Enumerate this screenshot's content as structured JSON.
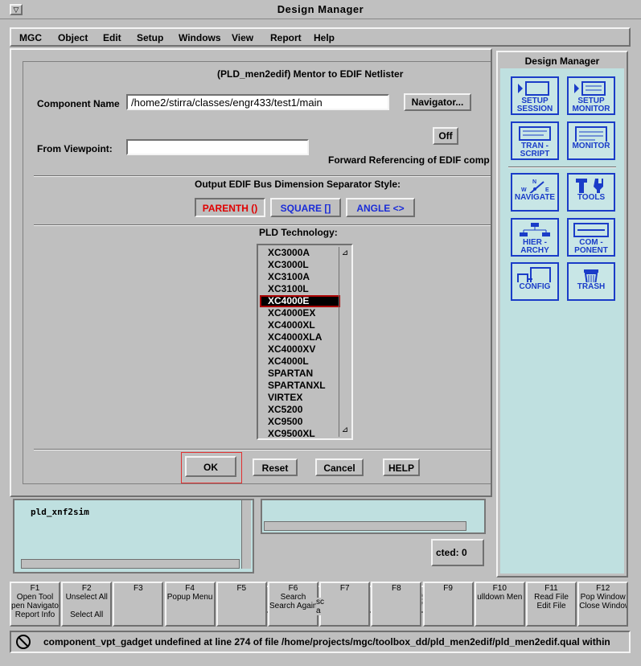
{
  "window": {
    "title": "Design Manager",
    "sys_menu_glyph": "▽"
  },
  "menubar": [
    {
      "label": "MGC"
    },
    {
      "label": "Object"
    },
    {
      "label": "Edit"
    },
    {
      "label": "Setup"
    },
    {
      "label": "Windows"
    },
    {
      "label": "View"
    },
    {
      "label": "Report"
    },
    {
      "label": "Help"
    }
  ],
  "dialog": {
    "title": "(PLD_men2edif) Mentor to EDIF Netlister",
    "component_name_label": "Component Name",
    "component_name_value": "/home2/stirra/classes/engr433/test1/main",
    "navigator_button": "Navigator...",
    "from_viewpoint_label": "From Viewpoint:",
    "from_viewpoint_value": "",
    "off_button": "Off",
    "forward_ref_label": "Forward Referencing of EDIF comp",
    "bus_separator_label": "Output EDIF Bus Dimension Separator Style:",
    "bus_options": [
      {
        "label": "PARENTH ()",
        "color": "#e00000",
        "selected": true
      },
      {
        "label": "SQUARE []",
        "color": "#1a2cd8",
        "selected": false
      },
      {
        "label": "ANGLE  <>",
        "color": "#1a2cd8",
        "selected": false
      }
    ],
    "pld_tech_label": "PLD Technology:",
    "pld_items": [
      "XC3000A",
      "XC3000L",
      "XC3100A",
      "XC3100L",
      "XC4000E",
      "XC4000EX",
      "XC4000XL",
      "XC4000XLA",
      "XC4000XV",
      "XC4000L",
      "SPARTAN",
      "SPARTANXL",
      "VIRTEX",
      "XC5200",
      "XC9500",
      "XC9500XL"
    ],
    "pld_selected": "XC4000E",
    "buttons": {
      "ok": "OK",
      "reset": "Reset",
      "cancel": "Cancel",
      "help": "HELP"
    }
  },
  "dm_panel": {
    "title": "Design Manager",
    "tools": [
      {
        "l1": "SETUP",
        "l2": "SESSION",
        "icon": "setup-session-icon"
      },
      {
        "l1": "SETUP",
        "l2": "MONITOR",
        "icon": "setup-monitor-icon"
      },
      {
        "l1": "TRAN -",
        "l2": "SCRIPT",
        "icon": "transcript-icon"
      },
      {
        "l1": "",
        "l2": "MONITOR",
        "icon": "monitor-icon"
      },
      {
        "l1": "",
        "l2": "NAVIGATE",
        "icon": "compass-icon"
      },
      {
        "l1": "",
        "l2": "TOOLS",
        "icon": "tools-icon"
      },
      {
        "l1": "HIER -",
        "l2": "ARCHY",
        "icon": "hierarchy-icon"
      },
      {
        "l1": "COM -",
        "l2": "PONENT",
        "icon": "component-icon"
      },
      {
        "l1": "",
        "l2": "CONFIG",
        "icon": "config-icon"
      },
      {
        "l1": "",
        "l2": "TRASH",
        "icon": "trash-icon"
      }
    ],
    "accent": "#1a3cc8"
  },
  "lower": {
    "list_item": "pld_xnf2sim",
    "selected_count": "cted: 0"
  },
  "fkeys": [
    {
      "name": "F1",
      "l1": "Open Tool",
      "l2": "pen Navigato",
      "l3": "Report Info"
    },
    {
      "name": "F2",
      "l1": "Unselect All",
      "l2": "",
      "l3": "Select All"
    },
    {
      "name": "F3",
      "l1": "",
      "l2": "",
      "l3": ""
    },
    {
      "name": "F4",
      "l1": "Popup Menu",
      "l2": "",
      "l3": ""
    },
    {
      "name": "F5",
      "l1": "",
      "l2": "",
      "l3": ""
    },
    {
      "name": "F6",
      "l1": "Search",
      "l2": "Search Again",
      "l3": ""
    },
    {
      "name": "F7",
      "l1": "",
      "l2": "",
      "l3": ""
    },
    {
      "name": "F8",
      "l1": "",
      "l2": "",
      "l3": ""
    },
    {
      "name": "F9",
      "l1": "",
      "l2": "",
      "l3": ""
    },
    {
      "name": "F10",
      "l1": "ulldown Men",
      "l2": "",
      "l3": ""
    },
    {
      "name": "F11",
      "l1": "Read File",
      "l2": "Edit File",
      "l3": ""
    },
    {
      "name": "F12",
      "l1": "Pop Window",
      "l2": "Close Window",
      "l3": ""
    }
  ],
  "fkey_sca": "sca",
  "status": {
    "message": "component_vpt_gadget undefined at line 274 of file /home/projects/mgc/toolbox_dd/pld_men2edif/pld_men2edif.qual within"
  }
}
